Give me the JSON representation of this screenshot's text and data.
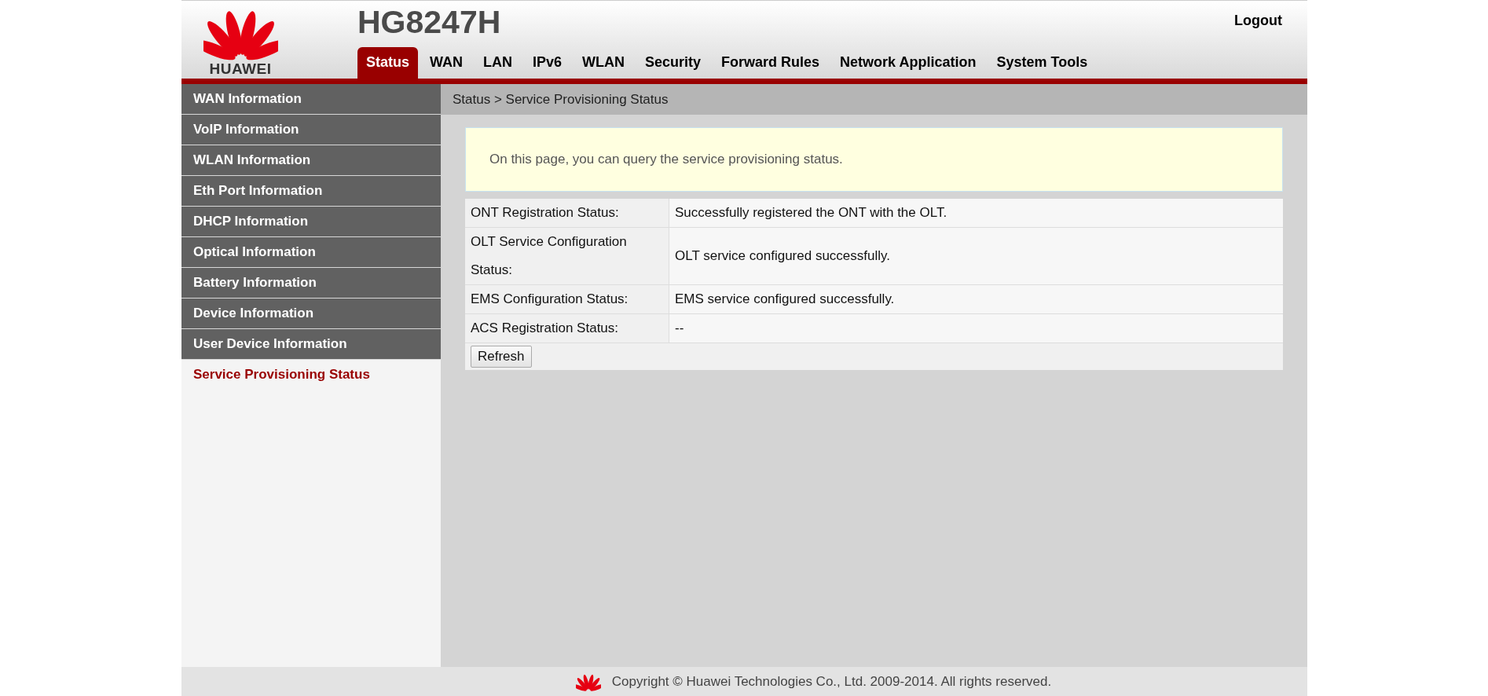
{
  "header": {
    "brand": "HUAWEI",
    "model": "HG8247H",
    "logout": "Logout"
  },
  "tabs": [
    {
      "label": "Status",
      "selected": true
    },
    {
      "label": "WAN",
      "selected": false
    },
    {
      "label": "LAN",
      "selected": false
    },
    {
      "label": "IPv6",
      "selected": false
    },
    {
      "label": "WLAN",
      "selected": false
    },
    {
      "label": "Security",
      "selected": false
    },
    {
      "label": "Forward Rules",
      "selected": false
    },
    {
      "label": "Network Application",
      "selected": false
    },
    {
      "label": "System Tools",
      "selected": false
    }
  ],
  "sidebar": {
    "items": [
      {
        "label": "WAN Information",
        "selected": false
      },
      {
        "label": "VoIP Information",
        "selected": false
      },
      {
        "label": "WLAN Information",
        "selected": false
      },
      {
        "label": "Eth Port Information",
        "selected": false
      },
      {
        "label": "DHCP Information",
        "selected": false
      },
      {
        "label": "Optical Information",
        "selected": false
      },
      {
        "label": "Battery Information",
        "selected": false
      },
      {
        "label": "Device Information",
        "selected": false
      },
      {
        "label": "User Device Information",
        "selected": false
      },
      {
        "label": "Service Provisioning Status",
        "selected": true
      }
    ]
  },
  "breadcrumb": "Status > Service Provisioning Status",
  "notice": "On this page, you can query the service provisioning status.",
  "table": {
    "rows": [
      {
        "label": "ONT Registration Status:",
        "value": "Successfully registered the ONT with the OLT."
      },
      {
        "label": "OLT Service Configuration Status:",
        "value": "OLT service configured successfully."
      },
      {
        "label": "EMS Configuration Status:",
        "value": "EMS service configured successfully."
      },
      {
        "label": "ACS Registration Status:",
        "value": "--"
      }
    ]
  },
  "buttons": [
    "Refresh"
  ],
  "footer": "Copyright © Huawei Technologies Co., Ltd. 2009-2014. All rights reserved."
}
